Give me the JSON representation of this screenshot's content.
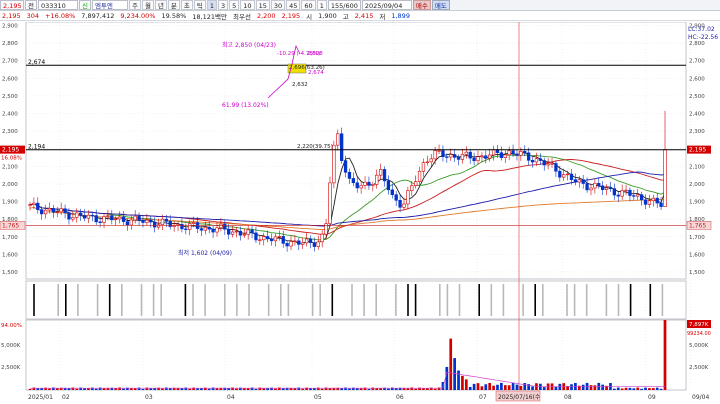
{
  "toolbar": {
    "price_label": "2,195",
    "code_prefix": "전",
    "stock_code": "033310",
    "search_label": "신",
    "stock_name": "엠투엔",
    "periods": [
      "주",
      "월",
      "년",
      "분",
      "초",
      "틱",
      "1",
      "3",
      "5",
      "10",
      "15",
      "30",
      "45",
      "60",
      "1"
    ],
    "active_period": "1",
    "count": "155/600",
    "date": "2025/09/04",
    "buy_label": "매수",
    "sell_label": "매도"
  },
  "quote": {
    "price": "2,195",
    "change": "304",
    "change_pct": "+16.08%",
    "volume": "7,897,412",
    "volume_change": "9,234.00%",
    "turnover_ratio": "19.58%",
    "amount": "18,121백만",
    "pref_label": "최우선",
    "pref_price": "2,200",
    "last_price": "2,195",
    "open_label": "시",
    "open": "1,900",
    "high_label": "고",
    "high": "2,415",
    "low_label": "저",
    "low": "1,899"
  },
  "colors": {
    "candle_up": "#d40000",
    "candle_down": "#0033cc",
    "ma5": "#222222",
    "ma20": "#3a9a2a",
    "ma60": "#c81e1e",
    "ma120": "#1e1eaa",
    "ma240": "#e07a2a",
    "annotation": "#cc00cc",
    "grid": "#d8d8d8"
  },
  "chart": {
    "price_axis": [
      "2,900",
      "2,800",
      "2,700",
      "2,600",
      "2,500",
      "2,400",
      "2,300",
      "2,200",
      "2,100",
      "2,000",
      "1,900",
      "1,800",
      "1,700",
      "1,600",
      "1,500"
    ],
    "x_axis": [
      "2025/01",
      "02",
      "03",
      "04",
      "05",
      "06",
      "07",
      "08",
      "09",
      "09/04"
    ],
    "crosshair_date": "2025/07/16(수",
    "hline_upper": "2,674",
    "hline_upper_price": 2674,
    "hline_mid": "2,194",
    "hline_mid_price": 2194,
    "hline_low": "1,765",
    "hline_low_price": 1765,
    "label_current": "2,195",
    "label_current_pct": "16.08%",
    "label_right_current": "2,195",
    "label_right_low": "1,765",
    "legend_lc": "LC:37.02",
    "legend_hc": "HC:-22.56",
    "high_note": "최고 2,850 (04/23)",
    "pct_note_top": "-10.29 (-4.78%)",
    "peak_label": "2,808",
    "box_label": "2,696(63.26)",
    "box_right": "2,674",
    "pt_2632": "2,632",
    "pct_note_left": "61.99 (13.02%)",
    "low_note": "최저 1,602 (04/09)",
    "mid_note": "2,220(39.75)"
  },
  "volume": {
    "left_label": "94.00%",
    "right_label_top": "7,897K",
    "right_label_bottom": "99234.00",
    "axis": [
      "5,000K",
      "2,500K"
    ],
    "right_axis": [
      "5,000K",
      "2,500K"
    ]
  }
}
